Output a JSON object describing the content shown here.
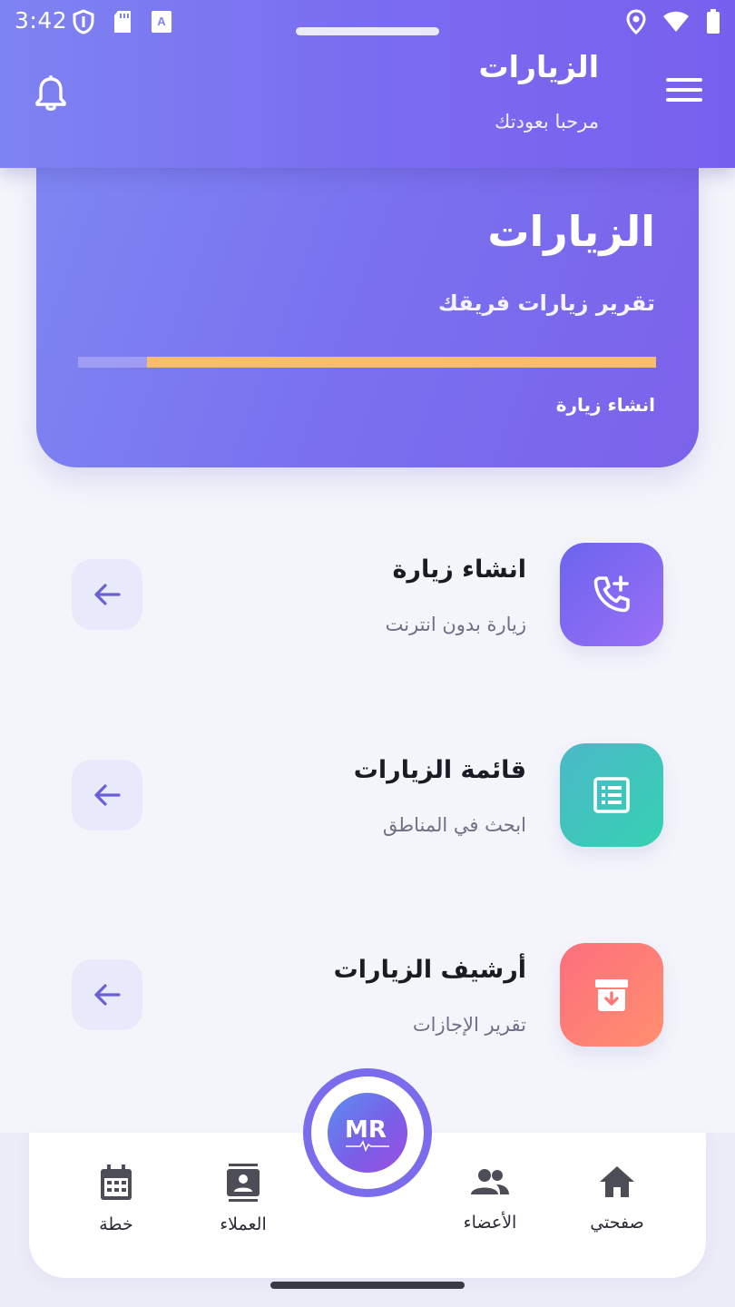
{
  "status_bar": {
    "time": "3:42"
  },
  "header": {
    "title": "الزيارات",
    "subtitle": "مرحبا بعودتك",
    "menu_icon": "hamburger-menu-icon",
    "bell_icon": "notification-bell-icon"
  },
  "hero": {
    "title": "الزيارات",
    "subtitle": "تقرير زيارات فريقك",
    "progress_fraction": 0.88,
    "action_label": "انشاء زيارة"
  },
  "list_items": [
    {
      "title": "انشاء زيارة",
      "subtitle": "زيارة بدون انترنت",
      "icon": "add-call-icon",
      "color_from": "#6b64ee",
      "color_to": "#9b6ff6"
    },
    {
      "title": "قائمة الزيارات",
      "subtitle": "ابحث في المناطق",
      "icon": "list-document-icon",
      "color_from": "#4bb8c8",
      "color_to": "#36d1b2"
    },
    {
      "title": "أرشيف الزيارات",
      "subtitle": "تقرير الإجازات",
      "icon": "archive-icon",
      "color_from": "#fd6f7e",
      "color_to": "#ff8f6e"
    }
  ],
  "bottom_nav": {
    "items": [
      {
        "label": "خطة",
        "icon": "calendar-icon"
      },
      {
        "label": "العملاء",
        "icon": "contacts-icon"
      },
      {
        "label": "الأعضاء",
        "icon": "group-icon"
      },
      {
        "label": "صفحتي",
        "icon": "home-icon"
      }
    ],
    "center_logo": "MR"
  },
  "colors": {
    "primary": "#7a6bf0",
    "progress_track": "#a09bf3",
    "progress_fill": "#f8bd6f",
    "arrow_bg": "#e8e9fb",
    "arrow_color": "#6b5fd9"
  }
}
